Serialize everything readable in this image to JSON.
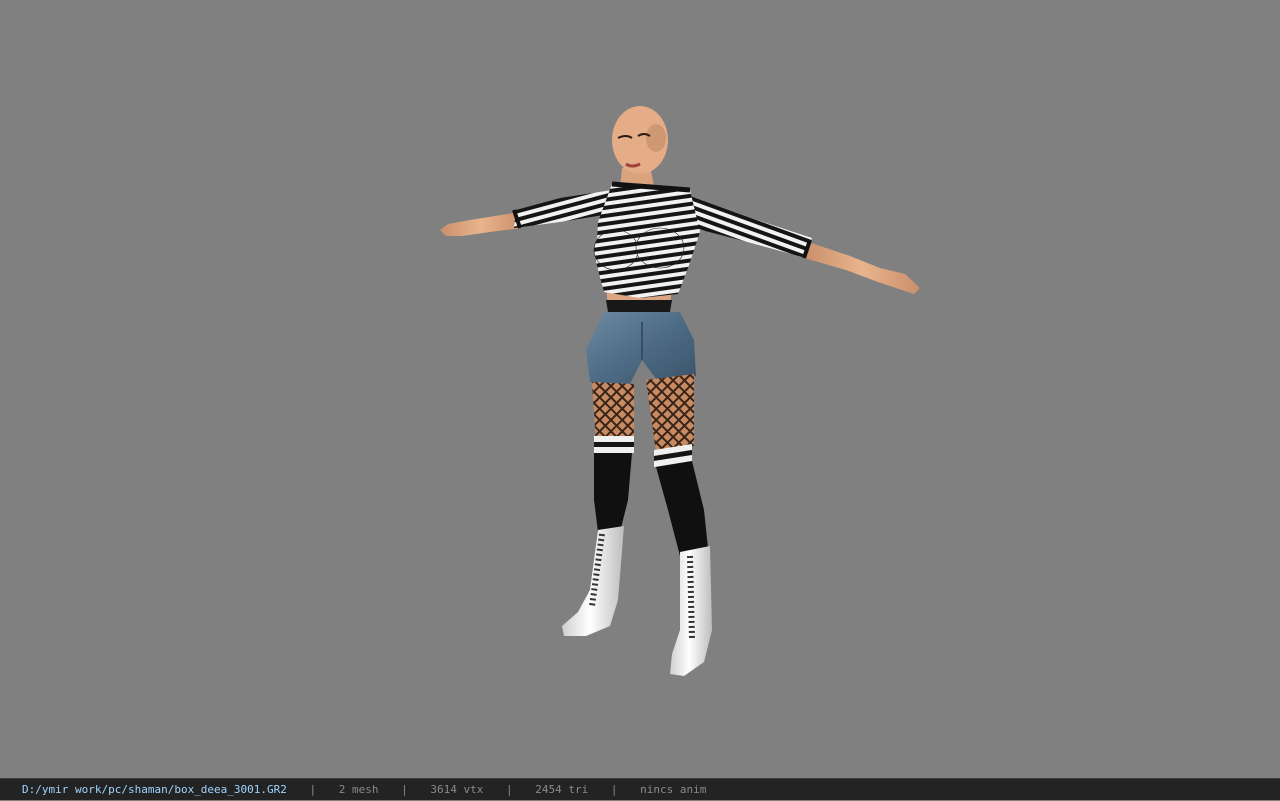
{
  "viewport": {
    "background_color": "#808080"
  },
  "model": {
    "label": "box_deea_3001 character model",
    "skin_color": "#e0a880",
    "stripe_dark": "#151515",
    "stripe_light": "#f2f2f2",
    "shorts_color": "#4e6c86",
    "stocking_color": "#c78a62",
    "sock_color": "#101010",
    "boot_color": "#efefef"
  },
  "status": {
    "file_path": "D:/ymir work/pc/shaman/box_deea_3001.GR2",
    "separator": "|",
    "mesh_count": "2 mesh",
    "vertex_count": "3614 vtx",
    "triangle_count": "2454 tri",
    "anim_status": "nincs anim"
  }
}
